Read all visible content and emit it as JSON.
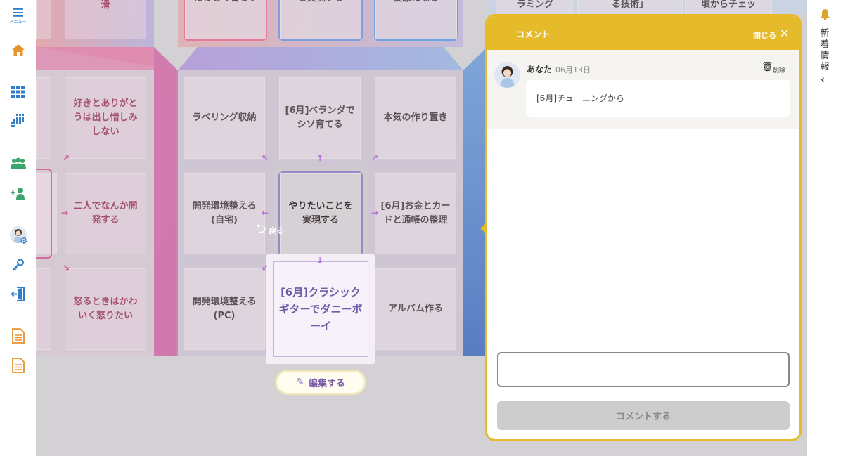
{
  "sidebar": {
    "menu_label": "メニュー"
  },
  "rightbar": {
    "news_label": "新着情報"
  },
  "grid": {
    "top_row": [
      "ニケーション円滑",
      "たのしく暮らす",
      "を実現する",
      "健康になる"
    ],
    "top_right": [
      "ラミング",
      "る技術」",
      "頃からチェッ"
    ],
    "left_col1": [
      "好きとありがとうは出し惜しみしない",
      "二人でなんか開発する",
      "怒るときはかわいく怒りたい"
    ],
    "center": [
      "ラベリング収納",
      "[6月]ベランダでシソ育てる",
      "本気の作り置き",
      "開発環境整える(自宅)",
      "やりたいことを実現する",
      "[6月]お金とカードと通帳の整理",
      "開発環境整える(PC)",
      "[6月]クラシックギターでダニーボーイ",
      "アルバム作る"
    ],
    "back_label": "戻る"
  },
  "edit_button": {
    "label": "編集する"
  },
  "comment_panel": {
    "title": "コメント",
    "close_label": "閉じる",
    "comments": [
      {
        "author": "あなた",
        "date": "06月13日",
        "delete_label": "削除",
        "text": "[6月]チューニングから"
      }
    ],
    "input_value": "",
    "submit_label": "コメントする"
  },
  "colors": {
    "accent_yellow": "#e5ba2b",
    "icon_blue": "#2f7fc6",
    "icon_green": "#3aa66b",
    "icon_orange": "#e8932e",
    "bell": "#d9a62a"
  }
}
